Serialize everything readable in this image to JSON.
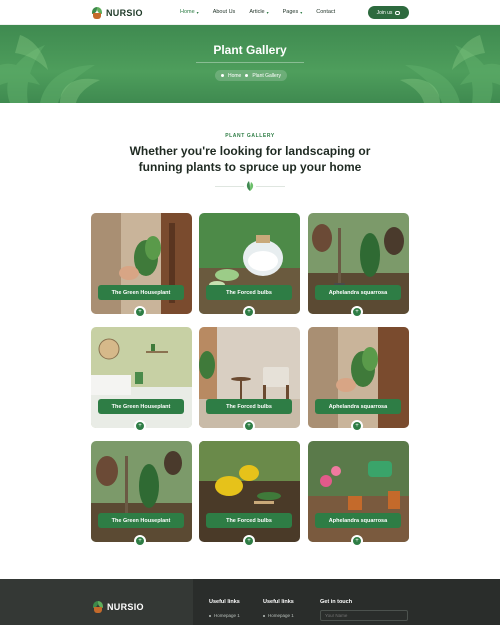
{
  "header": {
    "brand": "NURSIO",
    "nav": [
      {
        "label": "Home",
        "dropdown": true
      },
      {
        "label": "About Us",
        "dropdown": false
      },
      {
        "label": "Article",
        "dropdown": true
      },
      {
        "label": "Pages",
        "dropdown": true
      },
      {
        "label": "Contact",
        "dropdown": false
      }
    ],
    "join_label": "Join us"
  },
  "hero": {
    "title": "Plant Gallery",
    "breadcrumb": [
      "Home",
      "Plant Gallery"
    ]
  },
  "section": {
    "eyebrow": "PLANT GALLERY",
    "headline": "Whether you're looking for landscaping or funning plants to spruce up your home"
  },
  "gallery": [
    {
      "title": "The Green Houseplant",
      "plus": "+"
    },
    {
      "title": "The Forced bulbs",
      "plus": "+"
    },
    {
      "title": "Aphelandra squarrosa",
      "plus": "+"
    },
    {
      "title": "The Green Houseplant",
      "plus": "+"
    },
    {
      "title": "The Forced bulbs",
      "plus": "+"
    },
    {
      "title": "Aphelandra squarrosa",
      "plus": "+"
    },
    {
      "title": "The Green Houseplant",
      "plus": "+"
    },
    {
      "title": "The Forced bulbs",
      "plus": "+"
    },
    {
      "title": "Aphelandra squarrosa",
      "plus": "+"
    }
  ],
  "footer": {
    "brand": "NURSIO",
    "col1_title": "Useful links",
    "col1_link": "Homepage 1",
    "col2_title": "Useful links",
    "col2_link": "Homepage 1",
    "contact_title": "Get in touch",
    "contact_placeholder": "Your Name"
  },
  "colors": {
    "brand_green": "#2e7d45",
    "hero_green": "#4e9e5c",
    "footer_dark": "#2a2d2b"
  }
}
